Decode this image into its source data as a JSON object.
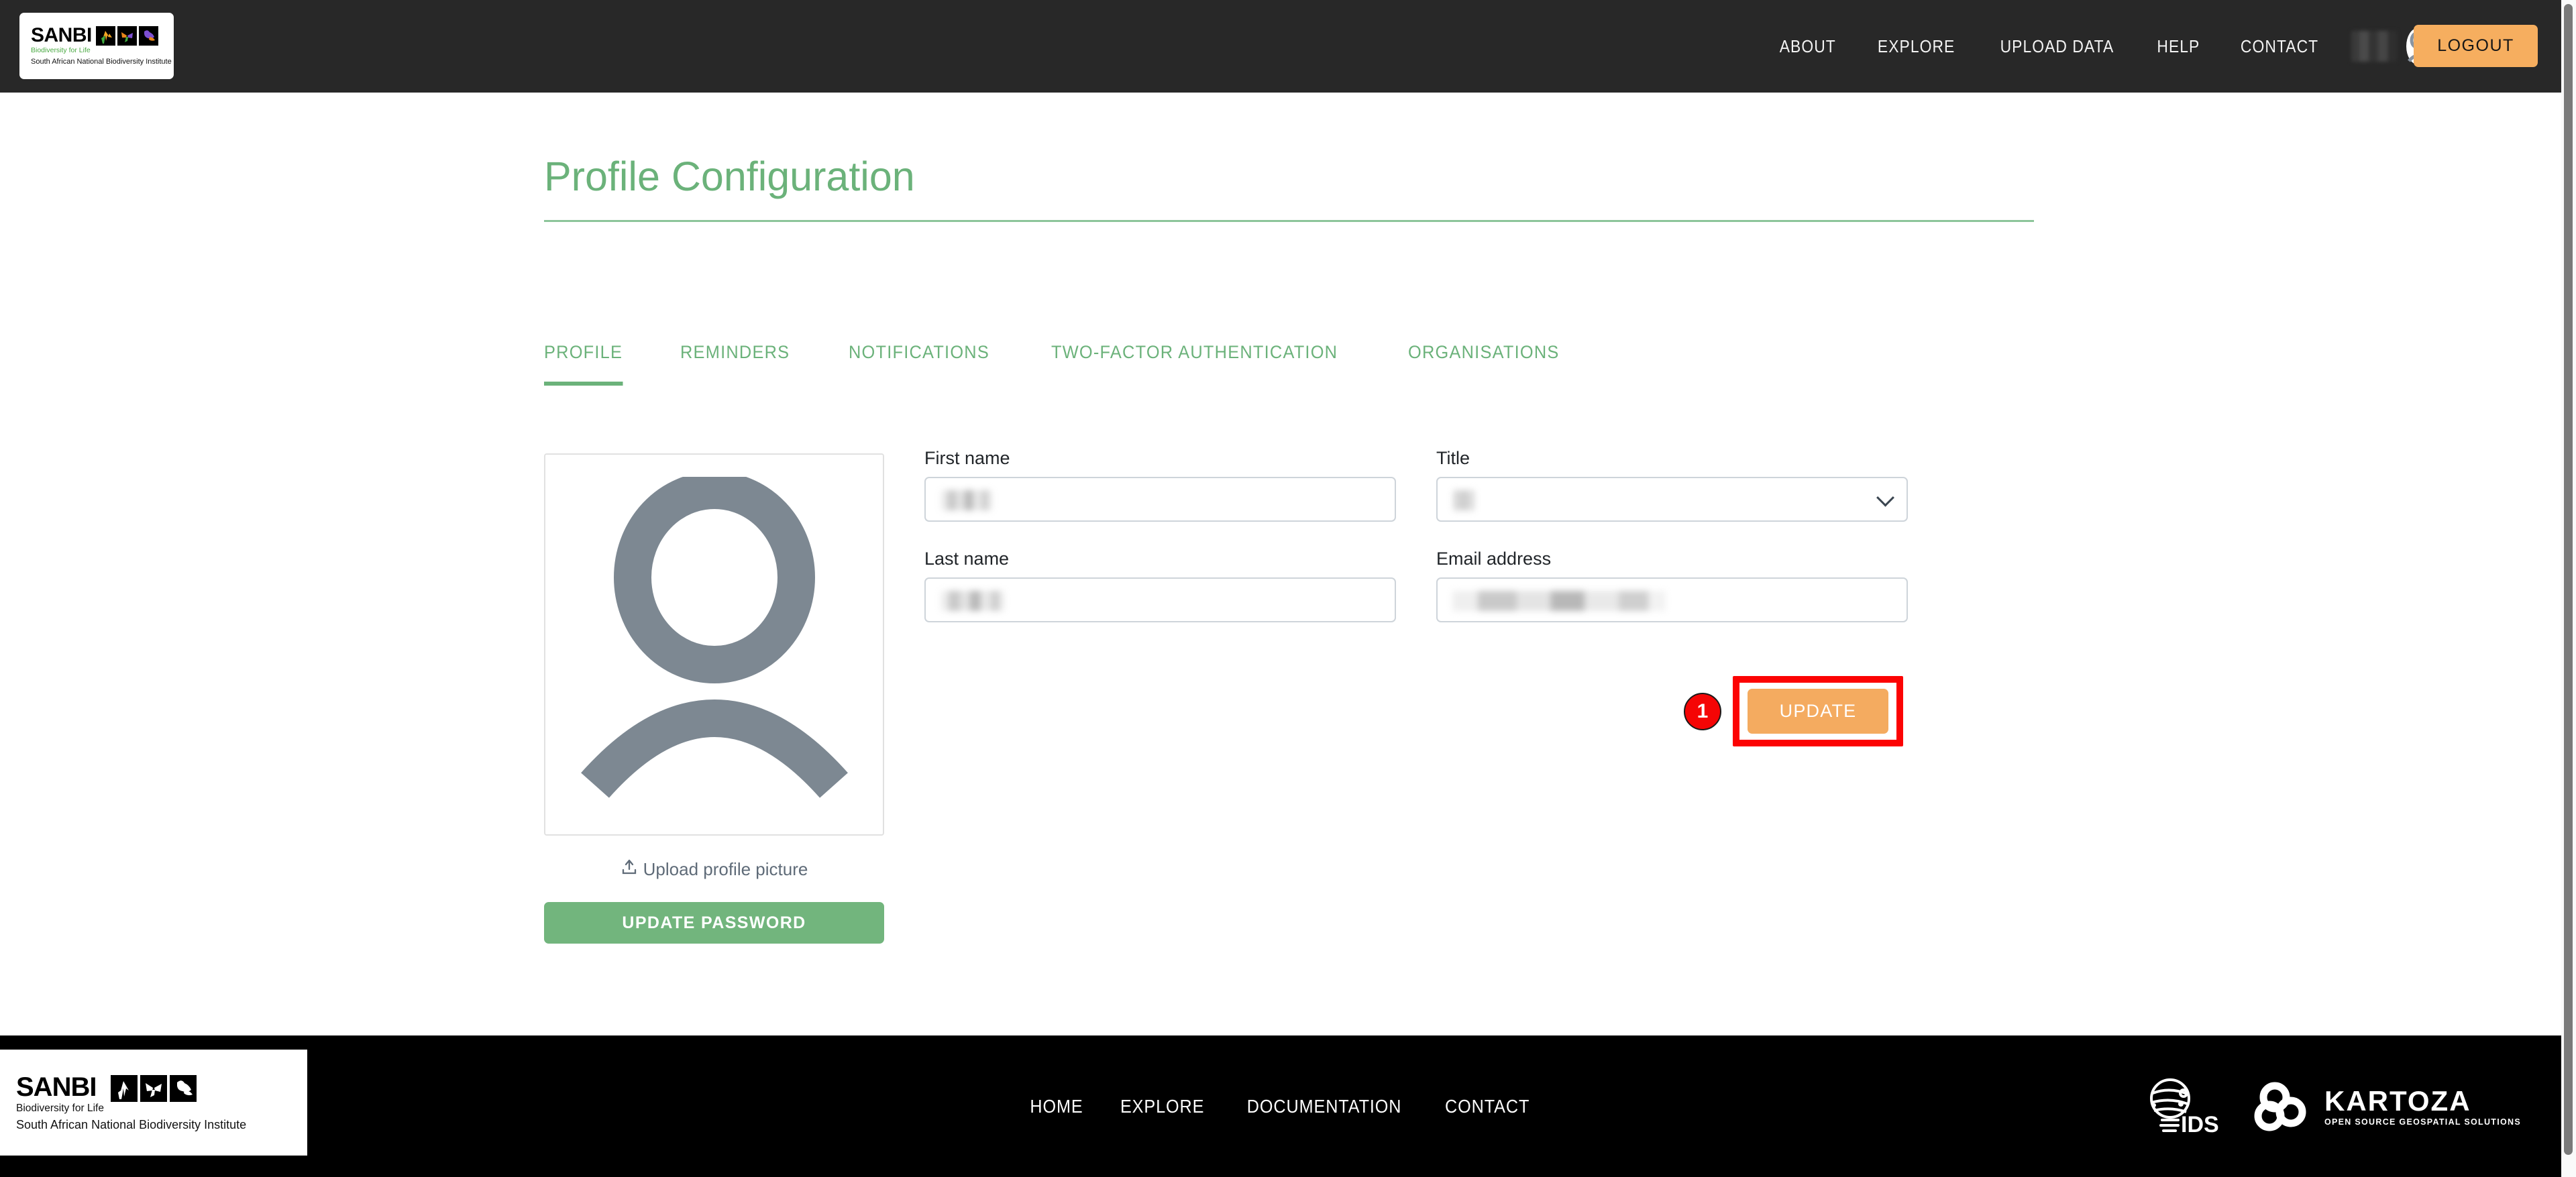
{
  "header": {
    "brand": {
      "name": "SANBI",
      "tagline": "Biodiversity for Life",
      "subtitle": "South African National Biodiversity Institute",
      "tiles": [
        "flower-icon",
        "butterfly-icon",
        "gecko-icon"
      ]
    },
    "nav": [
      {
        "label": "ABOUT"
      },
      {
        "label": "EXPLORE"
      },
      {
        "label": "UPLOAD DATA"
      },
      {
        "label": "HELP"
      },
      {
        "label": "CONTACT"
      }
    ],
    "user": {
      "name_redacted": "",
      "avatar_icon": "user-avatar-icon",
      "caret_icon": "chevron-down-icon"
    },
    "logout_label": "LOGOUT",
    "background_color": "#282828",
    "logout_color": "#f6ae5f"
  },
  "main": {
    "page_title": "Profile Configuration",
    "accent_color": "#6bb27a",
    "tabs": [
      {
        "label": "PROFILE",
        "active": true
      },
      {
        "label": "REMINDERS",
        "active": false
      },
      {
        "label": "NOTIFICATIONS",
        "active": false
      },
      {
        "label": "TWO-FACTOR AUTHENTICATION",
        "active": false
      },
      {
        "label": "ORGANISATIONS",
        "active": false
      }
    ],
    "profile_picture": {
      "placeholder_icon": "user-avatar-placeholder-icon",
      "upload_label": "Upload profile picture",
      "upload_icon": "upload-icon",
      "update_password_label": "UPDATE PASSWORD",
      "update_password_color": "#72b57d"
    },
    "form": {
      "first_name": {
        "label": "First name",
        "value_redacted": "",
        "value_width": 78
      },
      "last_name": {
        "label": "Last name",
        "value_redacted": "",
        "value_width": 96
      },
      "title": {
        "label": "Title",
        "value_redacted": "",
        "value_width": 34,
        "caret_icon": "chevron-down-icon"
      },
      "email": {
        "label": "Email address",
        "value_redacted": "",
        "value_width": 318
      },
      "update_label": "UPDATE",
      "update_color": "#f4ab60"
    },
    "annotation": {
      "badge_number": "1",
      "badge_color": "#f50505",
      "highlight_color": "#fc0303"
    }
  },
  "footer": {
    "brand": {
      "name": "SANBI",
      "tagline": "Biodiversity for Life",
      "subtitle": "South African National Biodiversity Institute"
    },
    "nav": [
      {
        "label": "HOME"
      },
      {
        "label": "EXPLORE"
      },
      {
        "label": "DOCUMENTATION"
      },
      {
        "label": "CONTACT"
      }
    ],
    "partners": [
      {
        "name": "IDS",
        "icon": "ids-globe-icon"
      },
      {
        "name": "KARTOZA",
        "tagline": "OPEN SOURCE GEOSPATIAL SOLUTIONS",
        "icon": "kartoza-knot-icon"
      }
    ],
    "background_color": "#000000"
  }
}
